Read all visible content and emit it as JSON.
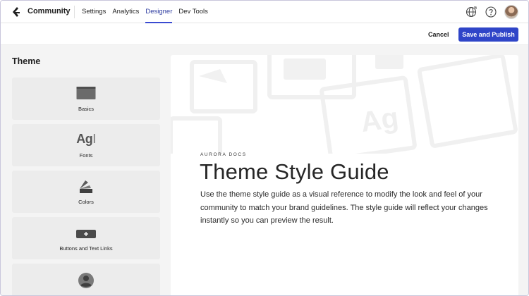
{
  "app": {
    "brand": "Community",
    "logo_icon": "aurora-logo-icon"
  },
  "nav": {
    "links": [
      {
        "label": "Settings",
        "active": false
      },
      {
        "label": "Analytics",
        "active": false
      },
      {
        "label": "Designer",
        "active": true
      },
      {
        "label": "Dev Tools",
        "active": false
      }
    ],
    "icons": [
      "globe-icon",
      "help-icon",
      "user-avatar"
    ]
  },
  "actions": {
    "cancel_label": "Cancel",
    "publish_label": "Save and Publish",
    "publish_color": "#2f45c8"
  },
  "sidebar": {
    "title": "Theme",
    "items": [
      {
        "label": "Basics",
        "icon": "browser-window-icon"
      },
      {
        "label": "Fonts",
        "icon": "font-icon",
        "glyph": "Ag"
      },
      {
        "label": "Colors",
        "icon": "color-swatch-icon"
      },
      {
        "label": "Buttons and Text Links",
        "icon": "button-plus-icon"
      },
      {
        "label": "",
        "icon": "avatar-icon"
      }
    ]
  },
  "preview": {
    "eyebrow": "AURORA DOCS",
    "title": "Theme Style Guide",
    "body": "Use the theme style guide as a visual reference to modify the look and feel of your community to match your brand guidelines. The style guide will reflect your changes instantly so you can preview the result."
  },
  "colors": {
    "accent": "#3a4bd1",
    "sidebar_bg": "#f4f4f4",
    "card_bg": "#ececec"
  }
}
